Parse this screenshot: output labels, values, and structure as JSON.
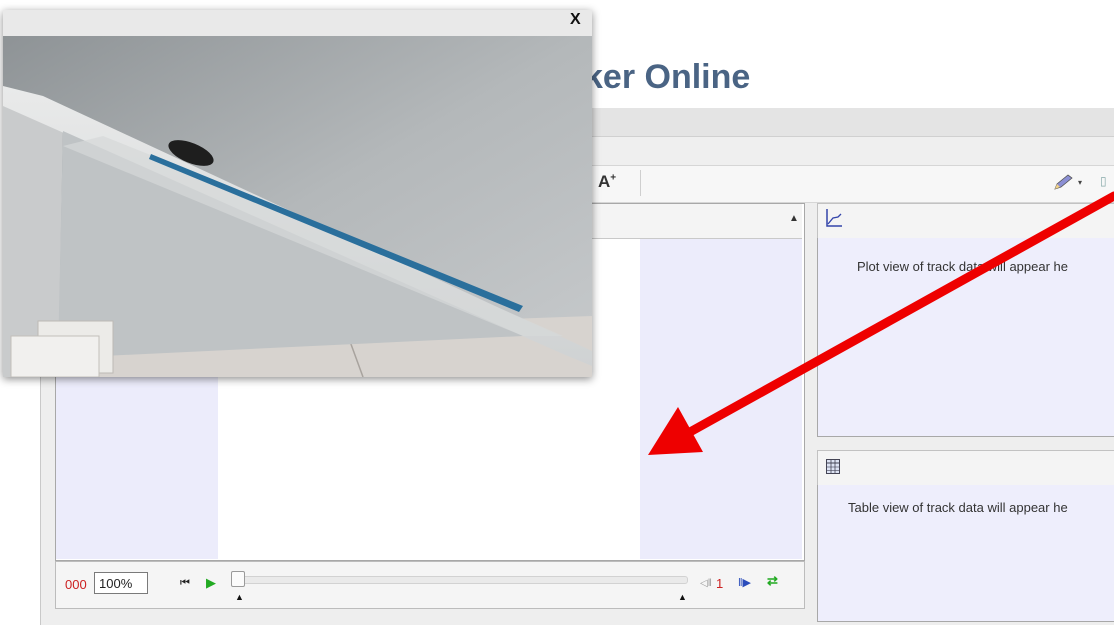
{
  "page": {
    "title": "ker Online"
  },
  "toolbar": {
    "font_size_icon": "font-size-increase-icon",
    "font_size_label": "A",
    "font_size_sup": "+",
    "pencil_icon": "pencil-icon",
    "dropdown_glyph": "▾",
    "calibration_glyph": "▯"
  },
  "video_panel": {
    "collapse_glyph": "▲"
  },
  "player": {
    "frame_counter": "000",
    "zoom_value": "100%",
    "rewind_glyph": "⏮",
    "play_glyph": "▶",
    "start_marker_glyph": "▲",
    "end_marker_glyph": "▲",
    "step_back_glyph": "◁‖",
    "step_size": "1",
    "step_forward_glyph": "‖▶",
    "loop_glyph": "⇄"
  },
  "plot_panel": {
    "icon": "plot-icon",
    "message": "Plot view of track data will appear he"
  },
  "table_panel": {
    "icon": "table-icon",
    "message": "Table view of track data will appear he"
  },
  "popup": {
    "close_label": "X",
    "image": "photo-of-inclined-ramp-with-rolling-ball"
  },
  "annotation": {
    "arrow_color": "#ee0000"
  },
  "colors": {
    "title": "#4a6484",
    "panel_bg": "#eeeefc",
    "frame_counter": "#cc2222",
    "play_green": "#22aa22"
  }
}
